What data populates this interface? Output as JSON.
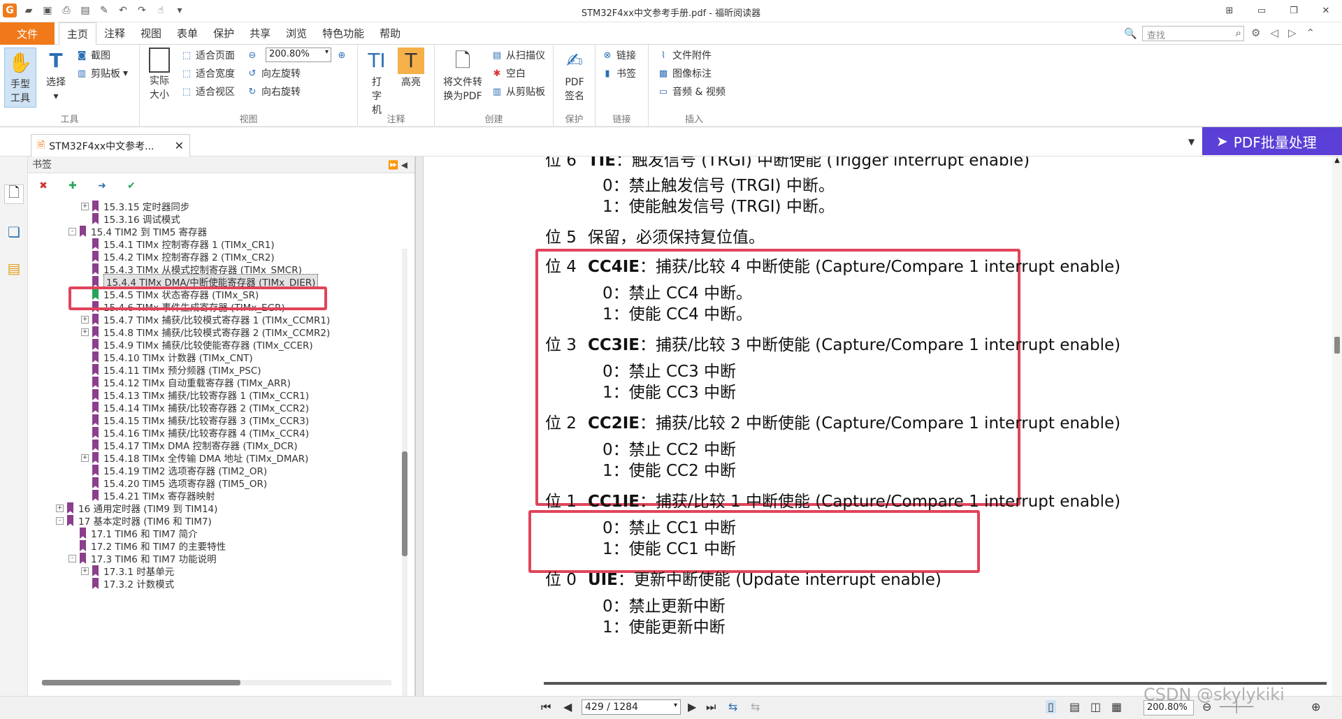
{
  "window": {
    "title": "STM32F4xx中文参考手册.pdf - 福昕阅读器"
  },
  "menu": {
    "file": "文件",
    "tabs": [
      "主页",
      "注释",
      "视图",
      "表单",
      "保护",
      "共享",
      "浏览",
      "特色功能",
      "帮助"
    ],
    "search_placeholder": "查找"
  },
  "ribbon": {
    "tools_group": "工具",
    "hand_tool": "手型工具",
    "select": "选择",
    "screenshot": "截图",
    "clipboard": "剪贴板",
    "actual_size": "实际大小",
    "fit_page": "适合页面",
    "fit_width": "适合宽度",
    "fit_visible": "适合视区",
    "zoom_value": "200.80%",
    "rotate_left": "向左旋转",
    "rotate_right": "向右旋转",
    "view_group": "视图",
    "typewriter": "打字机",
    "highlight": "高亮",
    "comment_group": "注释",
    "convert_pdf": "将文件转换为PDF",
    "from_scanner": "从扫描仪",
    "blank": "空白",
    "from_clipboard": "从剪贴板",
    "create_group": "创建",
    "pdf_sign": "PDF签名",
    "protect_group": "保护",
    "link": "链接",
    "bookmark": "书签",
    "link_group": "链接",
    "attachment": "文件附件",
    "image_annot": "图像标注",
    "audio_video": "音频 & 视频",
    "insert_group": "插入"
  },
  "doc_tab": {
    "name": "STM32F4xx中文参考...",
    "pdf_batch": "PDF批量处理"
  },
  "bookmarks": {
    "header": "书签",
    "items": [
      {
        "label": "15.3.15 定时器同步",
        "level": 3,
        "expand": "+"
      },
      {
        "label": "15.3.16 调试模式",
        "level": 3,
        "expand": ""
      },
      {
        "label": "15.4 TIM2 到 TIM5 寄存器",
        "level": 2,
        "expand": "-"
      },
      {
        "label": "15.4.1 TIMx 控制寄存器 1 (TIMx_CR1)",
        "level": 3,
        "expand": ""
      },
      {
        "label": "15.4.2 TIMx 控制寄存器 2 (TIMx_CR2)",
        "level": 3,
        "expand": ""
      },
      {
        "label": "15.4.3 TIMx 从模式控制寄存器 (TIMx_SMCR)",
        "level": 3,
        "expand": ""
      },
      {
        "label": "15.4.4 TIMx DMA/中断使能寄存器 (TIMx_DIER)",
        "level": 3,
        "expand": "",
        "selected": true
      },
      {
        "label": "15.4.5 TIMx 状态寄存器 (TIMx_SR)",
        "level": 3,
        "expand": "",
        "green": true
      },
      {
        "label": "15.4.6 TIMx 事件生成寄存器 (TIMx_EGR)",
        "level": 3,
        "expand": ""
      },
      {
        "label": "15.4.7 TIMx 捕获/比较模式寄存器 1 (TIMx_CCMR1)",
        "level": 3,
        "expand": "+"
      },
      {
        "label": "15.4.8 TIMx 捕获/比较模式寄存器 2 (TIMx_CCMR2)",
        "level": 3,
        "expand": "+"
      },
      {
        "label": "15.4.9 TIMx 捕获/比较使能寄存器 (TIMx_CCER)",
        "level": 3,
        "expand": ""
      },
      {
        "label": "15.4.10 TIMx 计数器 (TIMx_CNT)",
        "level": 3,
        "expand": ""
      },
      {
        "label": "15.4.11 TIMx 预分频器 (TIMx_PSC)",
        "level": 3,
        "expand": ""
      },
      {
        "label": "15.4.12 TIMx 自动重载寄存器 (TIMx_ARR)",
        "level": 3,
        "expand": ""
      },
      {
        "label": "15.4.13 TIMx 捕获/比较寄存器 1 (TIMx_CCR1)",
        "level": 3,
        "expand": ""
      },
      {
        "label": "15.4.14 TIMx 捕获/比较寄存器 2 (TIMx_CCR2)",
        "level": 3,
        "expand": ""
      },
      {
        "label": "15.4.15 TIMx 捕获/比较寄存器 3 (TIMx_CCR3)",
        "level": 3,
        "expand": ""
      },
      {
        "label": "15.4.16 TIMx 捕获/比较寄存器 4 (TIMx_CCR4)",
        "level": 3,
        "expand": ""
      },
      {
        "label": "15.4.17 TIMx DMA 控制寄存器 (TIMx_DCR)",
        "level": 3,
        "expand": ""
      },
      {
        "label": "15.4.18 TIMx 全传输 DMA 地址 (TIMx_DMAR)",
        "level": 3,
        "expand": "+"
      },
      {
        "label": "15.4.19 TIM2 选项寄存器 (TIM2_OR)",
        "level": 3,
        "expand": ""
      },
      {
        "label": "15.4.20 TIM5 选项寄存器 (TIM5_OR)",
        "level": 3,
        "expand": ""
      },
      {
        "label": "15.4.21 TIMx 寄存器映射",
        "level": 3,
        "expand": ""
      },
      {
        "label": "16 通用定时器 (TIM9 到 TIM14)",
        "level": 1,
        "expand": "+"
      },
      {
        "label": "17 基本定时器 (TIM6 和 TIM7)",
        "level": 1,
        "expand": "-"
      },
      {
        "label": "17.1 TIM6 和 TIM7 简介",
        "level": 2,
        "expand": ""
      },
      {
        "label": "17.2 TIM6 和 TIM7 的主要特性",
        "level": 2,
        "expand": ""
      },
      {
        "label": "17.3 TIM6 和 TIM7 功能说明",
        "level": 2,
        "expand": "-"
      },
      {
        "label": "17.3.1 时基单元",
        "level": 3,
        "expand": "+"
      },
      {
        "label": "17.3.2 计数模式",
        "level": 3,
        "expand": ""
      }
    ]
  },
  "document": {
    "lines": [
      {
        "bit": "位 6",
        "name": "TIE",
        "rest": "：触发信号 (TRGI) 中断使能 (Trigger interrupt enable)"
      },
      {
        "indent": "0：禁止触发信号 (TRGI) 中断。"
      },
      {
        "indent": "1：使能触发信号 (TRGI) 中断。"
      },
      {
        "bit": "位 5",
        "name": "",
        "rest": "保留，必须保持复位值。"
      },
      {
        "bit": "位 4",
        "name": "CC4IE",
        "rest": "：捕获/比较 4 中断使能 (Capture/Compare 1 interrupt enable)"
      },
      {
        "indent": "0：禁止 CC4 中断。"
      },
      {
        "indent": "1：使能 CC4 中断。"
      },
      {
        "bit": "位 3",
        "name": "CC3IE",
        "rest": "：捕获/比较 3 中断使能 (Capture/Compare 1 interrupt enable)"
      },
      {
        "indent": "0：禁止 CC3 中断"
      },
      {
        "indent": "1：使能 CC3 中断"
      },
      {
        "bit": "位 2",
        "name": "CC2IE",
        "rest": "：捕获/比较 2 中断使能 (Capture/Compare 1 interrupt enable)"
      },
      {
        "indent": "0：禁止 CC2 中断"
      },
      {
        "indent": "1：使能 CC2 中断"
      },
      {
        "bit": "位 1",
        "name": "CC1IE",
        "rest": "：捕获/比较 1 中断使能 (Capture/Compare 1 interrupt enable)"
      },
      {
        "indent": "0：禁止 CC1 中断"
      },
      {
        "indent": "1：使能 CC1 中断"
      },
      {
        "bit": "位 0",
        "name": "UIE",
        "rest": "：更新中断使能 (Update interrupt enable)"
      },
      {
        "indent": "0：禁止更新中断"
      },
      {
        "indent": "1：使能更新中断"
      }
    ]
  },
  "statusbar": {
    "page": "429 / 1284",
    "zoom": "200.80%"
  },
  "watermark": "CSDN @skylykiki",
  "colors": {
    "file_tab": "#f07a1a",
    "highlight_box": "#e0445a",
    "bookmark": "#8b3f8c",
    "pdf_batch": "#5b3fd6"
  }
}
